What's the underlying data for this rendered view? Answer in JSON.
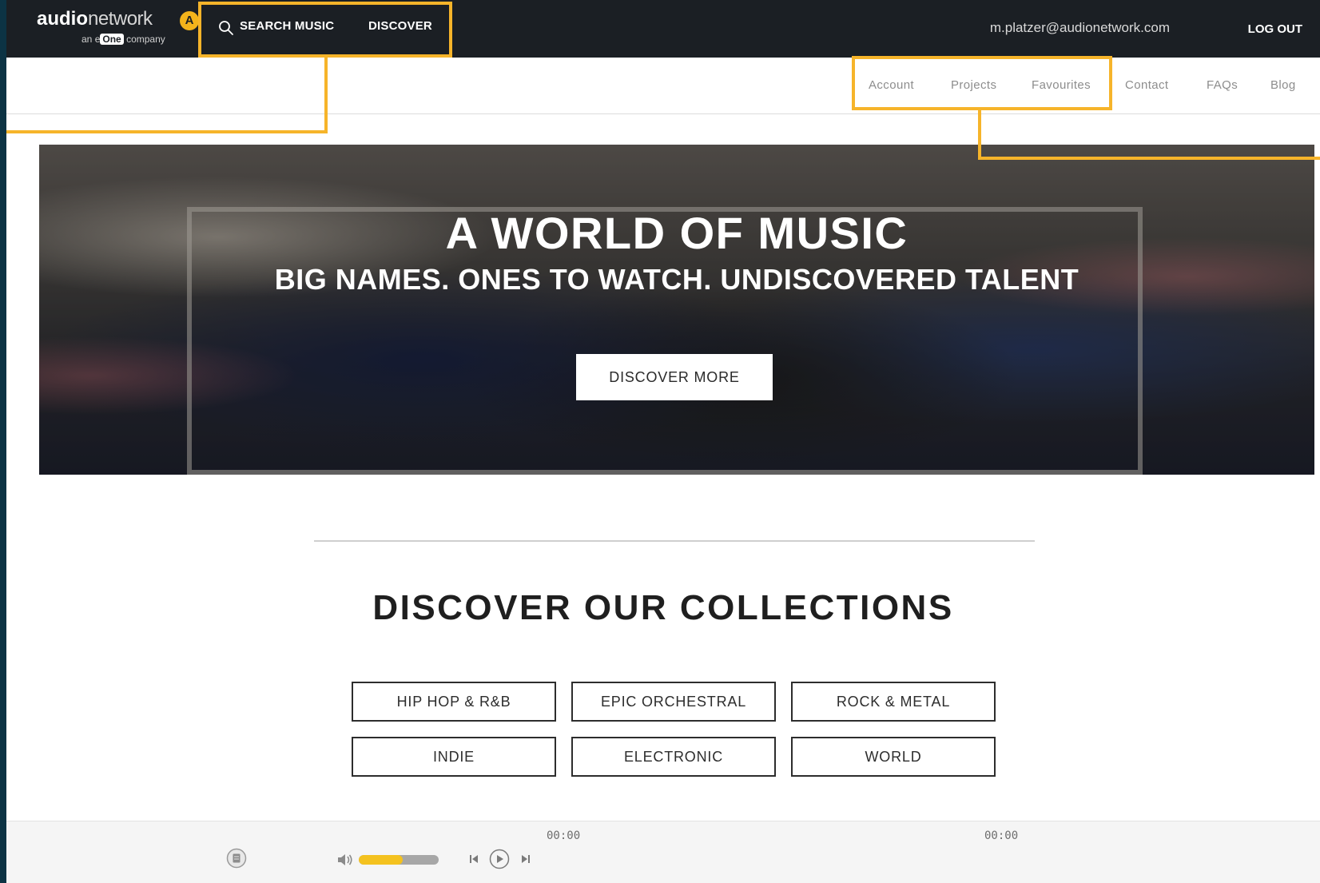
{
  "brand": {
    "name_bold": "audio",
    "name_light": "network",
    "badge": "A",
    "tagline_prefix": "an",
    "tagline_mark_e": "e",
    "tagline_mark_one": "One",
    "tagline_suffix": "company"
  },
  "topnav": {
    "search_label": "SEARCH MUSIC",
    "discover_label": "DISCOVER",
    "user_email": "m.platzer@audionetwork.com",
    "logout_label": "LOG OUT"
  },
  "subnav": {
    "items": [
      "Account",
      "Projects",
      "Favourites",
      "Contact",
      "FAQs",
      "Blog"
    ]
  },
  "hero": {
    "title": "A WORLD OF MUSIC",
    "subtitle": "BIG NAMES. ONES TO WATCH. UNDISCOVERED TALENT",
    "button_label": "DISCOVER MORE"
  },
  "collections": {
    "title": "DISCOVER OUR COLLECTIONS",
    "items": [
      "HIP HOP & R&B",
      "EPIC ORCHESTRAL",
      "ROCK & METAL",
      "INDIE",
      "ELECTRONIC",
      "WORLD"
    ]
  },
  "player": {
    "current_time": "00:00",
    "total_time": "00:00",
    "volume_fraction": 0.55,
    "icons": [
      "playlist-icon",
      "volume-icon",
      "previous-icon",
      "play-icon",
      "next-icon"
    ]
  },
  "colors": {
    "topbar": "#1b1f24",
    "accent": "#f6b42a",
    "volume": "#f4c21f",
    "outer_frame": "#0c3344"
  }
}
